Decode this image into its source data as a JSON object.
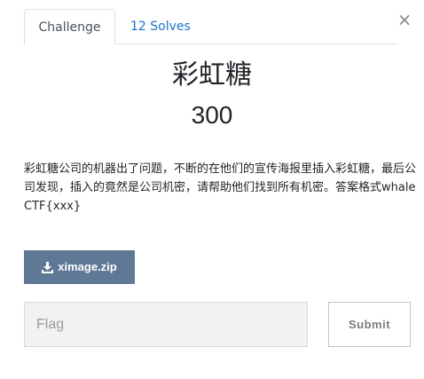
{
  "tabs": {
    "challenge": "Challenge",
    "solves": "12 Solves"
  },
  "close_label": "×",
  "challenge": {
    "name": "彩虹糖",
    "value": "300",
    "description": "彩虹糖公司的机器出了问题，不断的在他们的宣传海报里插入彩虹糖，最后公司发现，插入的竟然是公司机密，请帮助他们找到所有机密。答案格式whaleCTF{xxx}",
    "file": "ximage.zip"
  },
  "form": {
    "flag_placeholder": "Flag",
    "submit_label": "Submit"
  },
  "colors": {
    "tab_link": "#1a73c8",
    "file_button": "#5f7895",
    "input_bg": "#f2f2f2"
  },
  "icons": {
    "download": "download-icon",
    "close": "close-icon"
  }
}
